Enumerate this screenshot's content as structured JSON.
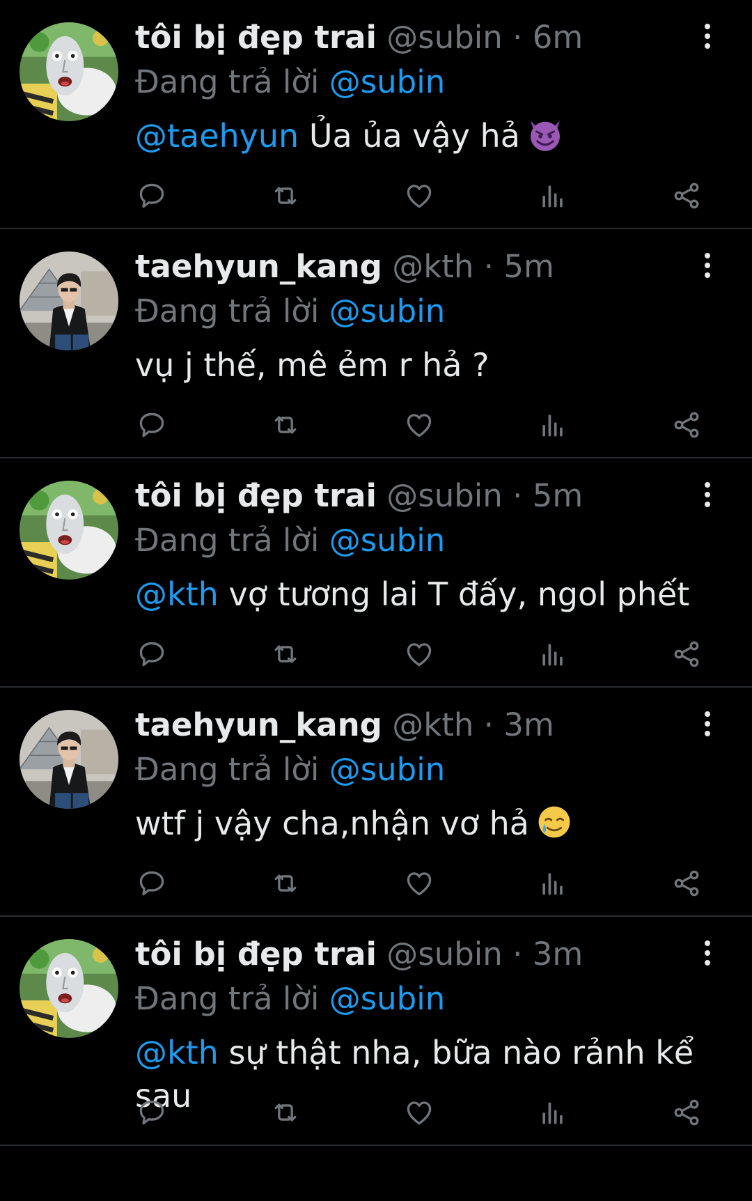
{
  "tweets": [
    {
      "author": "tôi bị đẹp trai",
      "handle": "@subin",
      "sep": "·",
      "time": "6m",
      "reply_prefix": "Đang trả lời",
      "reply_to": "@subin",
      "mention": "@taehyun",
      "text": " Ủa ủa vậy hả",
      "emoji": "smiling-imp-emoji",
      "avatar": "meme-face-avatar"
    },
    {
      "author": "taehyun_kang",
      "handle": "@kth",
      "sep": "·",
      "time": "5m",
      "reply_prefix": "Đang trả lời",
      "reply_to": "@subin",
      "mention": "",
      "text": "vụ j thế, mê ẻm r hả ?",
      "emoji": "",
      "avatar": "person-photo-avatar"
    },
    {
      "author": "tôi bị đẹp trai",
      "handle": "@subin",
      "sep": "·",
      "time": "5m",
      "reply_prefix": "Đang trả lời",
      "reply_to": "@subin",
      "mention": "@kth",
      "text": " vợ tương lai T đấy, ngol phết",
      "emoji": "",
      "avatar": "meme-face-avatar"
    },
    {
      "author": "taehyun_kang",
      "handle": "@kth",
      "sep": "·",
      "time": "3m",
      "reply_prefix": "Đang trả lời",
      "reply_to": "@subin",
      "mention": "",
      "text": "wtf j vậy cha,nhận vơ hả",
      "emoji": "smiling-face-with-tear-emoji",
      "avatar": "person-photo-avatar"
    },
    {
      "author": "tôi bị đẹp trai",
      "handle": "@subin",
      "sep": "·",
      "time": "3m",
      "reply_prefix": "Đang trả lời",
      "reply_to": "@subin",
      "mention": "@kth",
      "text": " sự thật nha, bữa nào rảnh kể sau",
      "emoji": "",
      "avatar": "meme-face-avatar"
    }
  ],
  "icons": {
    "reply": "reply-icon",
    "retweet": "retweet-icon",
    "like": "like-icon",
    "views": "views-icon",
    "share": "share-icon",
    "more": "more-icon"
  },
  "colors": {
    "background": "#000000",
    "text": "#e7e9ea",
    "muted": "#71767b",
    "link": "#1d9bf0",
    "divider": "#2a2d30"
  }
}
